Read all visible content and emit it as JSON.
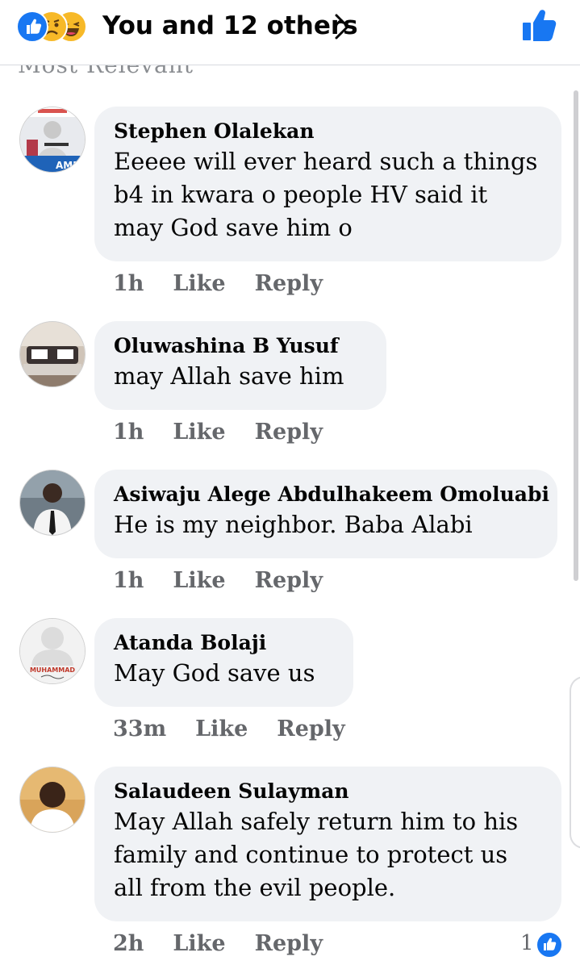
{
  "header": {
    "reactions": [
      "like-icon",
      "sad-icon",
      "haha-icon"
    ],
    "summary": "You and 12 others",
    "chevron": "chevron-right-icon",
    "like_button_icon": "thumbs-up-icon"
  },
  "cutoff_text": "Most Relevant",
  "actions": {
    "like": "Like",
    "reply": "Reply"
  },
  "comments": [
    {
      "name": "Stephen Olalekan",
      "text": "Eeeee will ever heard such a things b4 in kwara o  people HV said it may God save him o",
      "time": "1h",
      "avatar_overlay": "AME"
    },
    {
      "name": "Oluwashina B Yusuf",
      "text": "may Allah save him",
      "time": "1h"
    },
    {
      "name": "Asiwaju Alege Abdulhakeem Omoluabi",
      "text": "He is my neighbor. Baba Alabi",
      "time": "1h"
    },
    {
      "name": "Atanda Bolaji",
      "text": "May God save us",
      "time": "33m",
      "avatar_overlay": "MUHAMMAD"
    },
    {
      "name": "Salaudeen Sulayman",
      "text": "May Allah safely return him to his family and continue to protect us all from the evil people.",
      "time": "2h",
      "reaction_count": "1"
    }
  ],
  "colors": {
    "brand_blue": "#1877f2",
    "bubble": "#f0f2f5",
    "meta_gray": "#65676b"
  }
}
